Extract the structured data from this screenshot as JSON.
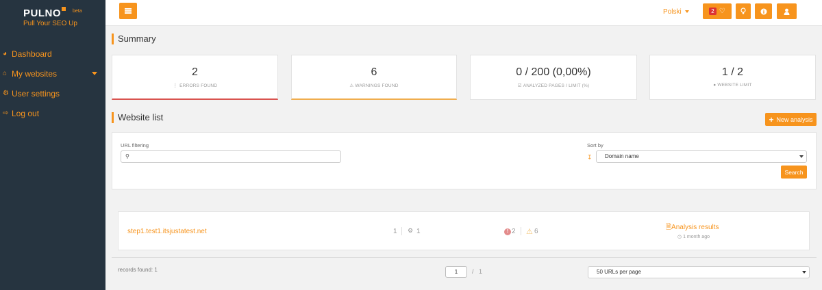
{
  "brand": {
    "name": "PULNO",
    "beta": "beta",
    "tagline": "Pull Your SEO Up"
  },
  "sidebar": {
    "items": [
      {
        "label": "Dashboard",
        "icon": "dashboard-icon"
      },
      {
        "label": "My websites",
        "icon": "home-icon"
      },
      {
        "label": "User settings",
        "icon": "cogs-icon"
      },
      {
        "label": "Log out",
        "icon": "sign-out-icon"
      }
    ]
  },
  "topbar": {
    "language": "Polski",
    "notification_count": "2"
  },
  "summary": {
    "title": "Summary",
    "cards": [
      {
        "value": "2",
        "label": "ERRORS FOUND"
      },
      {
        "value": "6",
        "label": "WARNINGS FOUND"
      },
      {
        "value": "0 / 200 (0,00%)",
        "label": "ANALYZED PAGES / LIMIT (%)"
      },
      {
        "value": "1 / 2",
        "label": "WEBSITE LIMIT"
      }
    ]
  },
  "website_list": {
    "title": "Website list",
    "new_analysis_label": "New analysis"
  },
  "filter": {
    "url_label": "URL filtering",
    "url_value": "",
    "sort_label": "Sort by",
    "sort_value": "Domain name",
    "search_label": "Search"
  },
  "results": [
    {
      "domain": "step1.test1.itsjustatest.net",
      "pages": "1",
      "subpages": "1",
      "errors": "2",
      "warnings": "6",
      "analysis_label": "Analysis results",
      "time_ago": "1 month ago"
    }
  ],
  "footer": {
    "records_found": "records found: 1",
    "current_page": "1",
    "page_separator": "/",
    "total_pages": "1",
    "per_page": "50 URLs per page"
  },
  "colors": {
    "accent": "#f7941d",
    "sidebar_bg": "#263440",
    "error": "#d9534f",
    "warning": "#f0ad4e"
  }
}
